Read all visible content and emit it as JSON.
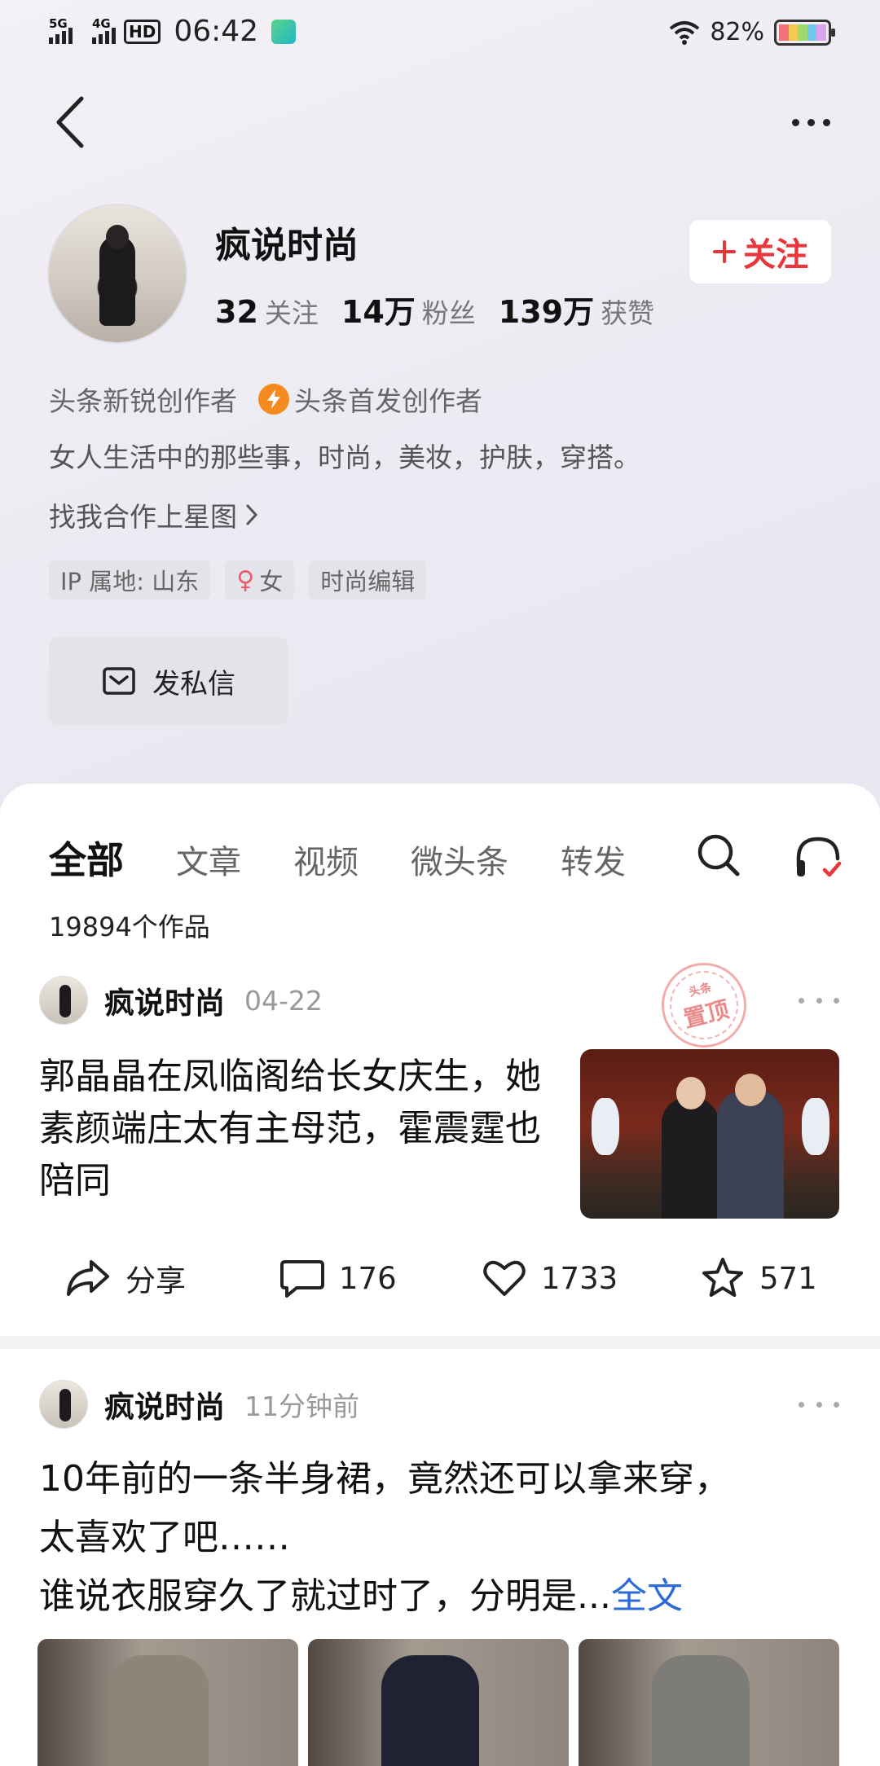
{
  "status_bar": {
    "net1": "5G",
    "net2": "4G",
    "hd": "HD",
    "time": "06:42",
    "battery_pct": "82%",
    "battery_level": 0.82
  },
  "profile": {
    "name": "疯说时尚",
    "follow_label": "关注",
    "stats": [
      {
        "value": "32",
        "label": "关注"
      },
      {
        "value": "14万",
        "label": "粉丝"
      },
      {
        "value": "139万",
        "label": "获赞"
      }
    ],
    "badge1": "头条新锐创作者",
    "badge2": "头条首发创作者",
    "bio": "女人生活中的那些事，时尚，美妆，护肤，穿搭。",
    "star_link": "找我合作上星图",
    "tags": [
      "IP 属地: 山东",
      "女",
      "时尚编辑"
    ],
    "dm_label": "发私信"
  },
  "tabs": [
    "全部",
    "文章",
    "视频",
    "微头条",
    "转发"
  ],
  "works_count": "19894个作品",
  "posts": [
    {
      "author": "疯说时尚",
      "time": "04-22",
      "pinned_stamp_small": "头条",
      "pinned_stamp": "置顶",
      "title": "郭晶晶在凤临阁给长女庆生，她素颜端庄太有主母范，霍震霆也陪同",
      "share_label": "分享",
      "comments": "176",
      "likes": "1733",
      "favorites": "571"
    },
    {
      "author": "疯说时尚",
      "time": "11分钟前",
      "title_line1": "10年前的一条半身裙，竟然还可以拿来穿，",
      "title_line2": "太喜欢了吧……",
      "title_line3": "谁说衣服穿久了就过时了，分明是...",
      "full_text_link": "全文"
    }
  ],
  "colors": {
    "accent_red": "#e8363b",
    "link_blue": "#2a6bd9",
    "badge_orange": "#f58a1f"
  }
}
